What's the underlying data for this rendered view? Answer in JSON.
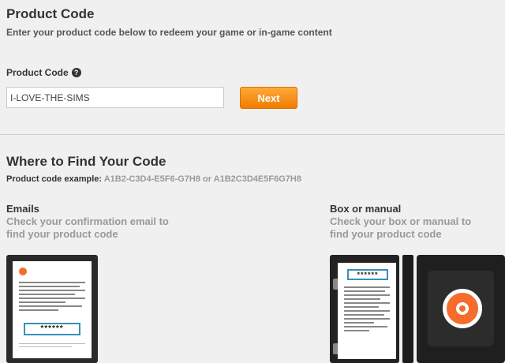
{
  "header": {
    "title": "Product Code",
    "subtitle": "Enter your product code below to redeem your game or in-game content"
  },
  "form": {
    "label": "Product Code",
    "help_icon": "?",
    "input_value": "I-LOVE-THE-SIMS",
    "next_label": "Next"
  },
  "find": {
    "title": "Where to Find Your Code",
    "example_label": "Product code example:",
    "example_value": "A1B2-C3D4-E5F6-G7H8 or A1B2C3D4E5F6G7H8"
  },
  "emails": {
    "title": "Emails",
    "description": "Check your confirmation email to find your product code",
    "masked_code": "******"
  },
  "box": {
    "title": "Box or manual",
    "description": "Check your box or manual to find your product code",
    "masked_code": "******"
  },
  "colors": {
    "accent": "#f07c00",
    "background": "#f0f0f0",
    "muted_text": "#999999",
    "origin_orange": "#f56c2d"
  }
}
